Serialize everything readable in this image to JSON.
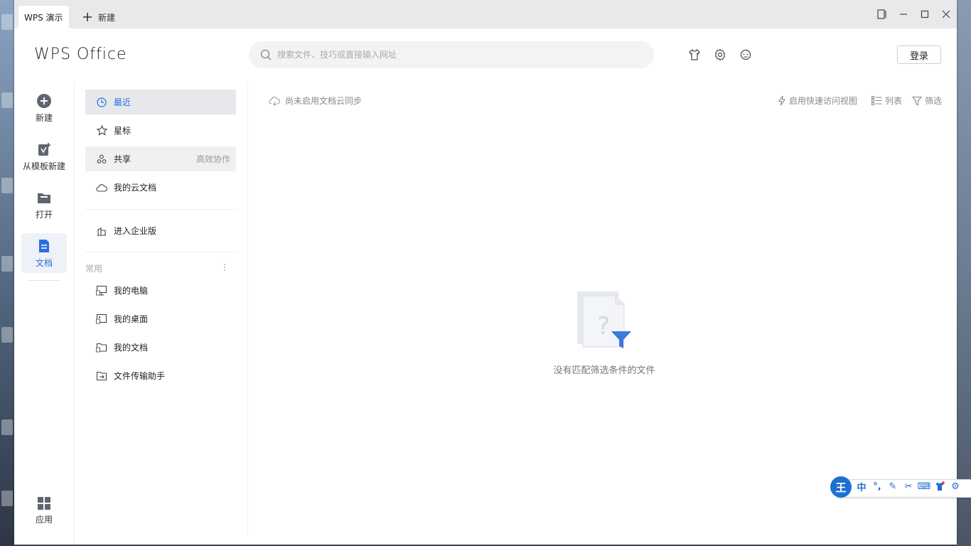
{
  "titlebar": {
    "active_tab": "WPS 演示",
    "new_tab": "新建"
  },
  "header": {
    "logo": "WPS Office",
    "search_placeholder": "搜索文件、技巧或直接输入网址",
    "icons": [
      "skin-shirt-icon",
      "settings-gear-icon",
      "feedback-chat-icon"
    ],
    "login_label": "登录"
  },
  "leftnav": {
    "items": [
      {
        "label": "新建",
        "icon": "plus-circle-icon"
      },
      {
        "label": "从模板新建",
        "icon": "template-icon"
      },
      {
        "label": "打开",
        "icon": "folder-icon"
      },
      {
        "label": "文档",
        "icon": "document-icon",
        "active": true
      }
    ],
    "apps_label": "应用"
  },
  "sidenav": {
    "items": [
      {
        "label": "最近",
        "icon": "clock-icon",
        "active": true
      },
      {
        "label": "星标",
        "icon": "star-icon"
      },
      {
        "label": "共享",
        "icon": "share-icon",
        "extra": "高效协作"
      },
      {
        "label": "我的云文档",
        "icon": "cloud-icon"
      }
    ],
    "enterprise_label": "进入企业版",
    "section_label": "常用",
    "section_more": "⋮",
    "common": [
      {
        "label": "我的电脑",
        "icon": "computer-icon"
      },
      {
        "label": "我的桌面",
        "icon": "desktop-icon"
      },
      {
        "label": "我的文档",
        "icon": "my-documents-icon"
      },
      {
        "label": "文件传输助手",
        "icon": "file-transfer-icon"
      }
    ]
  },
  "content": {
    "sync_text": "尚未启用文档云同步",
    "quick_view": "启用快速访问视图",
    "list_label": "列表",
    "filter_label": "筛选",
    "empty_message": "没有匹配筛选条件的文件"
  },
  "ime": {
    "logo": "王",
    "keys": [
      "中",
      "°,",
      "✎",
      "✂",
      "⌨",
      "shirt",
      "⚙"
    ]
  },
  "colors": {
    "accent": "#2a6de0",
    "ime_blue": "#1f6fd1"
  }
}
